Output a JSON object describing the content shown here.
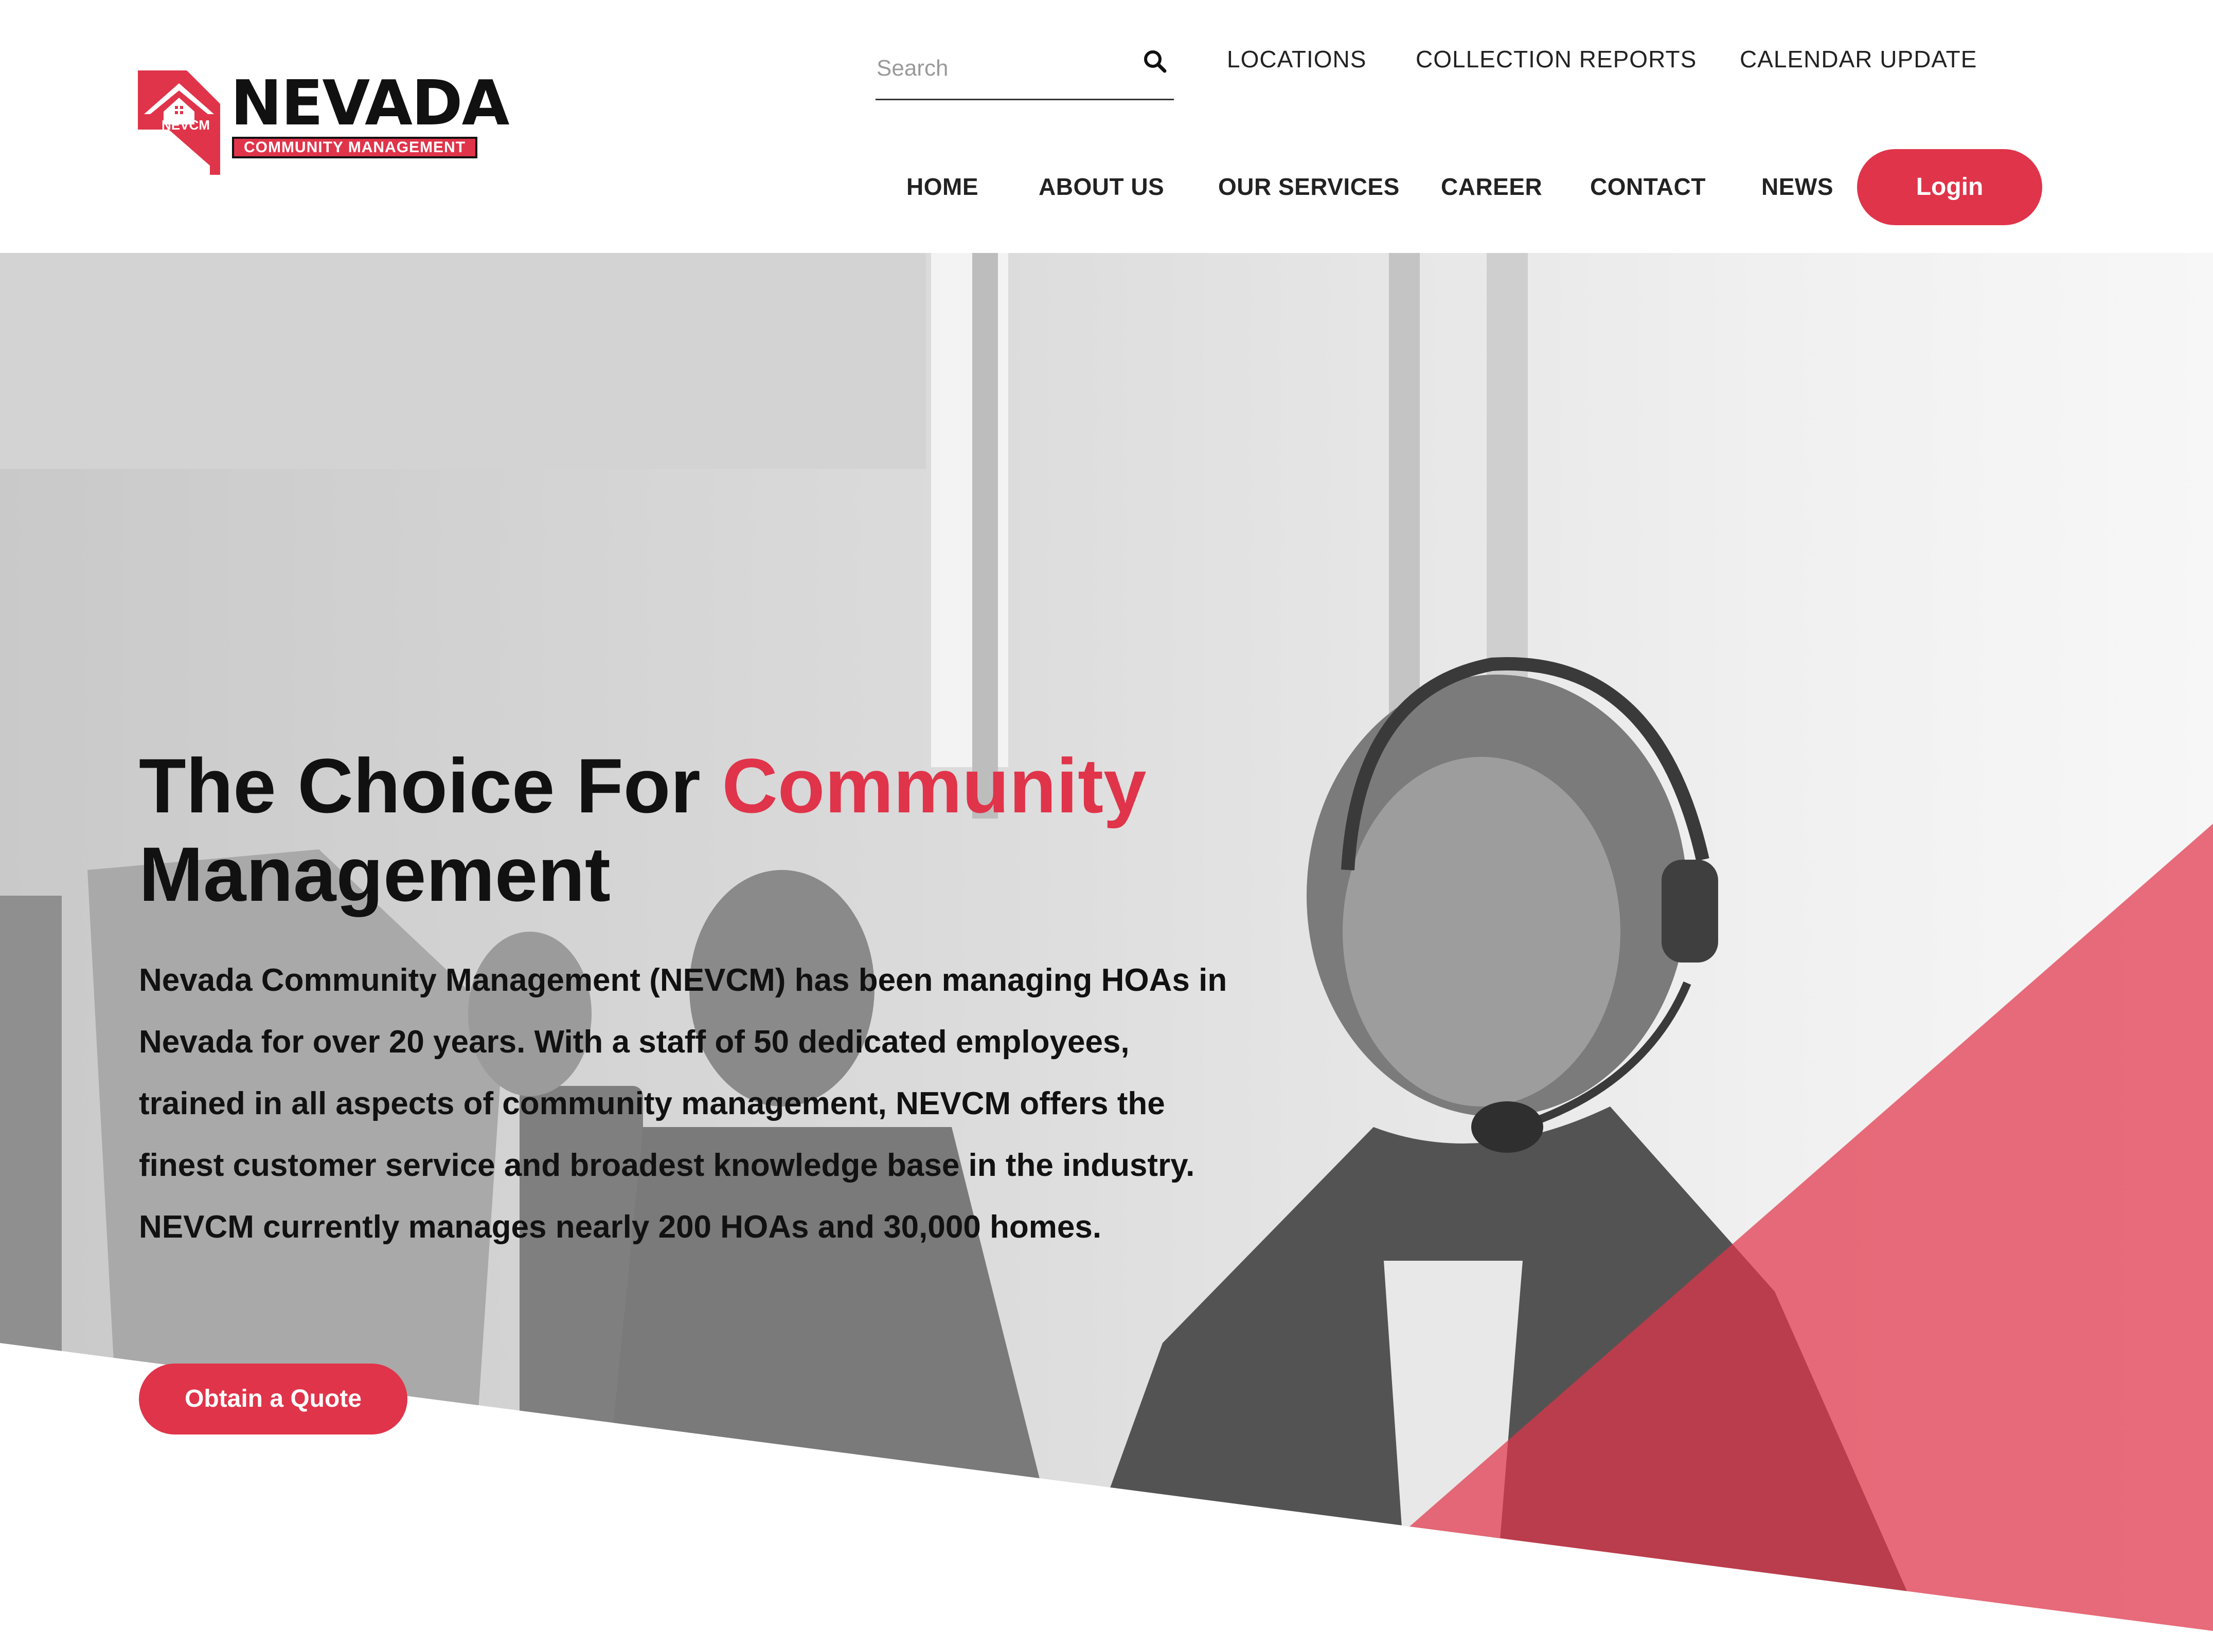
{
  "logo": {
    "wordmark": "NEVADA",
    "tagline": "COMMUNITY MANAGEMENT",
    "badge": "NEVCM",
    "icon": "house-on-nevada-state-icon"
  },
  "search": {
    "placeholder": "Search",
    "value": "",
    "icon": "search-icon"
  },
  "utility_nav": [
    {
      "label": "LOCATIONS"
    },
    {
      "label": "COLLECTION REPORTS"
    },
    {
      "label": "CALENDAR UPDATE"
    }
  ],
  "main_nav": [
    {
      "label": "HOME"
    },
    {
      "label": "ABOUT US"
    },
    {
      "label": "OUR SERVICES"
    },
    {
      "label": "CAREER"
    },
    {
      "label": "CONTACT"
    },
    {
      "label": "NEWS"
    }
  ],
  "login": {
    "label": "Login"
  },
  "hero": {
    "title_part1": "The Choice For ",
    "title_accent": "Community",
    "title_part2": "Management",
    "description": "Nevada Community Management (NEVCM) has been managing HOAs in Nevada for over 20 years. With a staff of 50 dedicated employees, trained in all aspects of community management, NEVCM offers the finest customer service and broadest knowledge base in the industry. NEVCM currently manages nearly 200 HOAs and 30,000 homes.",
    "cta_label": "Obtain a Quote",
    "image_subject": "call-center-agent-with-headset"
  },
  "colors": {
    "accent": "#e0344a",
    "text": "#111111",
    "nav_text": "#222222",
    "background": "#ffffff"
  }
}
